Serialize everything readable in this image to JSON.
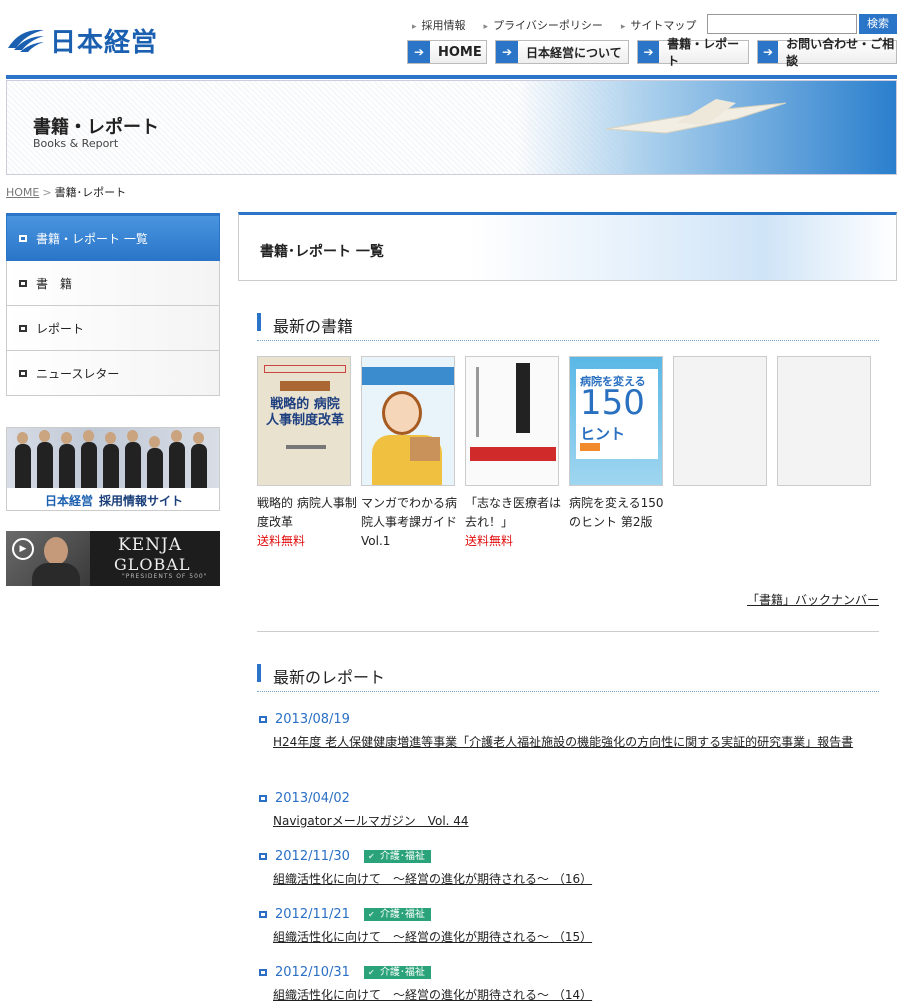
{
  "header": {
    "logo_text": "日本経営",
    "util_links": [
      "採用情報",
      "プライバシーポリシー",
      "サイトマップ"
    ],
    "search": {
      "placeholder": "",
      "button": "検索"
    },
    "nav": [
      {
        "label": "HOME"
      },
      {
        "label": "日本経営について"
      },
      {
        "label": "書籍・レポート"
      },
      {
        "label": "お問い合わせ・ご相談"
      }
    ]
  },
  "banner": {
    "title": "書籍・レポート",
    "subtitle": "Books & Report"
  },
  "breadcrumb": {
    "home": "HOME",
    "separator": ">",
    "current": "書籍･レポート"
  },
  "sidebar": {
    "items": [
      {
        "label": "書籍・レポート 一覧",
        "active": true
      },
      {
        "label": "書　籍"
      },
      {
        "label": "レポート"
      },
      {
        "label": "ニュースレター"
      }
    ],
    "recruit_banner": {
      "brand": "日本経営",
      "label": "採用情報サイト"
    },
    "kenja_banner": {
      "line1": "KENJA",
      "line2": "GLOBAL",
      "line3": "\"PRESIDENTS OF 500\""
    }
  },
  "main": {
    "page_title": "書籍･レポート 一覧",
    "books_section": {
      "title": "最新の書籍",
      "books": [
        {
          "title": "戦略的 病院人事制度改革",
          "note": "送料無料",
          "cover_text": "戦略的 病院人事制度改革"
        },
        {
          "title": "マンガでわかる病院人事考課ガイド Vol.1",
          "note": ""
        },
        {
          "title": "「志なき医療者は去れ！」",
          "note": "送料無料"
        },
        {
          "title": "病院を変える150のヒント 第2版",
          "note": "",
          "cover_top": "病院を変える",
          "cover_num": "150",
          "cover_bottom": "ヒント"
        }
      ],
      "back_number": "「書籍」バックナンバー"
    },
    "reports_section": {
      "title": "最新のレポート",
      "reports": [
        {
          "date": "2013/08/19",
          "badge": "",
          "title": "H24年度 老人保健健康増進等事業「介護老人福祉施設の機能強化の方向性に関する実証的研究事業」報告書"
        },
        {
          "date": "2013/04/02",
          "badge": "",
          "title": "Navigatorメールマガジン　Vol. 44"
        },
        {
          "date": "2012/11/30",
          "badge": "介護･福祉",
          "title": "組織活性化に向けて　～経営の進化が期待される～ （16）"
        },
        {
          "date": "2012/11/21",
          "badge": "介護･福祉",
          "title": "組織活性化に向けて　～経営の進化が期待される～ （15）"
        },
        {
          "date": "2012/10/31",
          "badge": "介護･福祉",
          "title": "組織活性化に向けて　～経営の進化が期待される～ （14）"
        }
      ]
    }
  },
  "colors": {
    "accent": "#2a75c8",
    "free_shipping": "#e01010",
    "badge": "#2aa37a"
  }
}
